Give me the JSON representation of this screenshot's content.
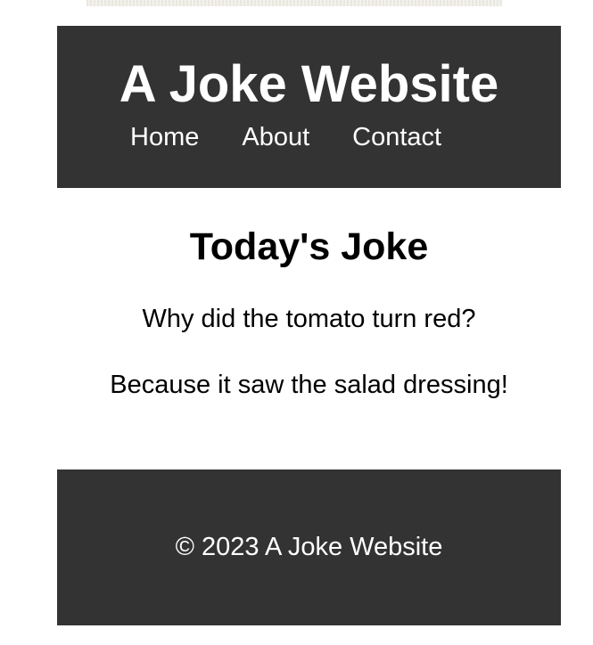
{
  "header": {
    "title": "A Joke Website",
    "nav": [
      {
        "label": "Home"
      },
      {
        "label": "About"
      },
      {
        "label": "Contact"
      }
    ]
  },
  "main": {
    "heading": "Today's Joke",
    "question": "Why did the tomato turn red?",
    "answer": "Because it saw the salad dressing!"
  },
  "footer": {
    "text": "© 2023 A Joke Website"
  },
  "colors": {
    "header_bg": "#333333",
    "footer_bg": "#333333",
    "text_light": "#ffffff",
    "text_dark": "#000000"
  }
}
